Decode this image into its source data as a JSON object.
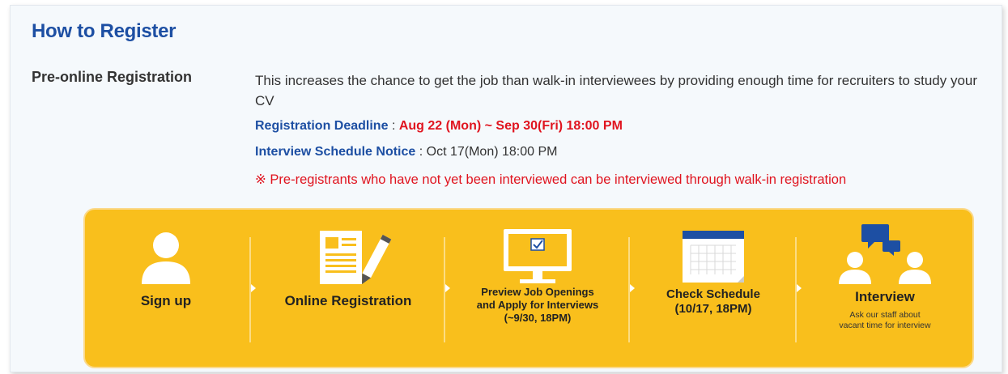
{
  "header": {
    "title": "How to Register"
  },
  "section": {
    "label": "Pre-online Registration",
    "description": "This increases the chance to get the job than walk-in interviewees by providing enough time for recruiters to study your CV",
    "deadline_key": "Registration Deadline",
    "deadline_value": "Aug 22 (Mon) ~ Sep 30(Fri) 18:00 PM",
    "schedule_key": "Interview Schedule Notice",
    "schedule_value": "Oct 17(Mon) 18:00 PM",
    "separator": ":",
    "note": "※ Pre-registrants who have not yet been interviewed can be interviewed through walk-in registration"
  },
  "steps": [
    {
      "label": "Sign up",
      "icon": "user-icon"
    },
    {
      "label": "Online Registration",
      "icon": "form-pencil-icon"
    },
    {
      "line1": "Preview Job Openings",
      "line2": "and Apply for Interviews",
      "line3": "(~9/30, 18PM)",
      "icon": "monitor-check-icon"
    },
    {
      "line1": "Check Schedule",
      "line2": "(10/17, 18PM)",
      "icon": "calendar-icon"
    },
    {
      "label": "Interview",
      "sub1": "Ask our staff about",
      "sub2": "vacant time for interview",
      "icon": "interview-chat-icon"
    }
  ],
  "colors": {
    "accent_blue": "#1d4fa3",
    "alert_red": "#e0141f",
    "box_yellow": "#f9bf1c",
    "icon_blue": "#1d4fa3"
  }
}
